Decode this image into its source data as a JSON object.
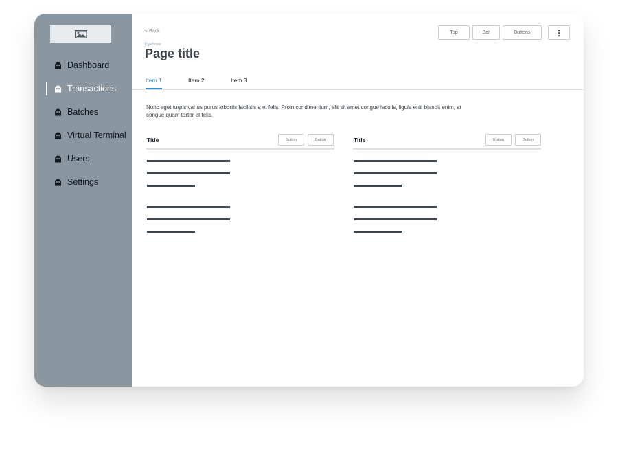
{
  "sidebar": {
    "logo_icon": "image-placeholder-icon",
    "items": [
      {
        "label": "Dashboard",
        "icon": "ghost-icon"
      },
      {
        "label": "Transactions",
        "icon": "ghost-icon",
        "active": true
      },
      {
        "label": "Batches",
        "icon": "ghost-icon"
      },
      {
        "label": "Virtual Terminal",
        "icon": "ghost-icon"
      },
      {
        "label": "Users",
        "icon": "ghost-icon"
      },
      {
        "label": "Settings",
        "icon": "ghost-icon"
      }
    ]
  },
  "header": {
    "back_label": "< Back",
    "eyebrow": "Eyebrow",
    "title": "Page title",
    "top_buttons": [
      "Top",
      "Bar",
      "Buttons"
    ],
    "more_label": "⋮"
  },
  "tabs": [
    {
      "label": "Item 1",
      "active": true
    },
    {
      "label": "Item 2"
    },
    {
      "label": "Item 3"
    }
  ],
  "body_text": "Nunc eget turpis varius purus lobortis facilisis a et felis. Proin condimentum, elit sit amet congue iaculis, ligula erat blandit enim, at congue quam tortor et felis.",
  "cards": [
    {
      "title": "Title",
      "buttons": [
        "Button",
        "Button"
      ]
    },
    {
      "title": "Title",
      "buttons": [
        "Button",
        "Button"
      ]
    }
  ],
  "colors": {
    "sidebar": "#8a96a0",
    "accent": "#3d8fc4",
    "text_dark": "#3f464d"
  }
}
